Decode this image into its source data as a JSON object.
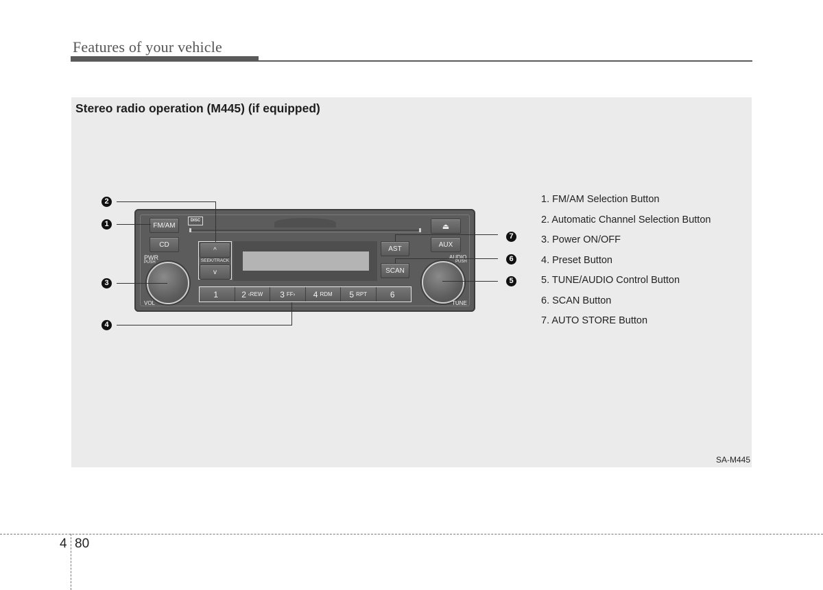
{
  "header": {
    "title": "Features of your vehicle"
  },
  "section": {
    "title": "Stereo radio operation (M445) (if equipped)",
    "figure_code": "SA-M445"
  },
  "radio": {
    "buttons": {
      "fm_am": "FM/AM",
      "cd": "CD",
      "eject": "⏏",
      "aux": "AUX",
      "ast": "AST",
      "scan": "SCAN",
      "seek_up": "^",
      "seek_down": "v",
      "seek_label": "SEEK/TRACK"
    },
    "labels": {
      "pwr": "PWR",
      "pwr_push": "PUSH",
      "vol": "VOL",
      "audio": "AUDIO",
      "audio_push": "PUSH",
      "tune": "TUNE",
      "cd_logo": "DISC"
    },
    "presets": [
      {
        "num": "1",
        "sub": ""
      },
      {
        "num": "2",
        "sub": "‹REW"
      },
      {
        "num": "3",
        "sub": "FF›"
      },
      {
        "num": "4",
        "sub": "RDM"
      },
      {
        "num": "5",
        "sub": "RPT"
      },
      {
        "num": "6",
        "sub": ""
      }
    ]
  },
  "callouts": [
    "1",
    "2",
    "3",
    "4",
    "5",
    "6",
    "7"
  ],
  "legend": [
    "1. FM/AM Selection Button",
    "2. Automatic Channel Selection Button",
    "3. Power ON/OFF",
    "4. Preset Button",
    "5. TUNE/AUDIO Control Button",
    "6. SCAN Button",
    "7. AUTO STORE Button"
  ],
  "footer": {
    "chapter": "4",
    "page": "80"
  }
}
